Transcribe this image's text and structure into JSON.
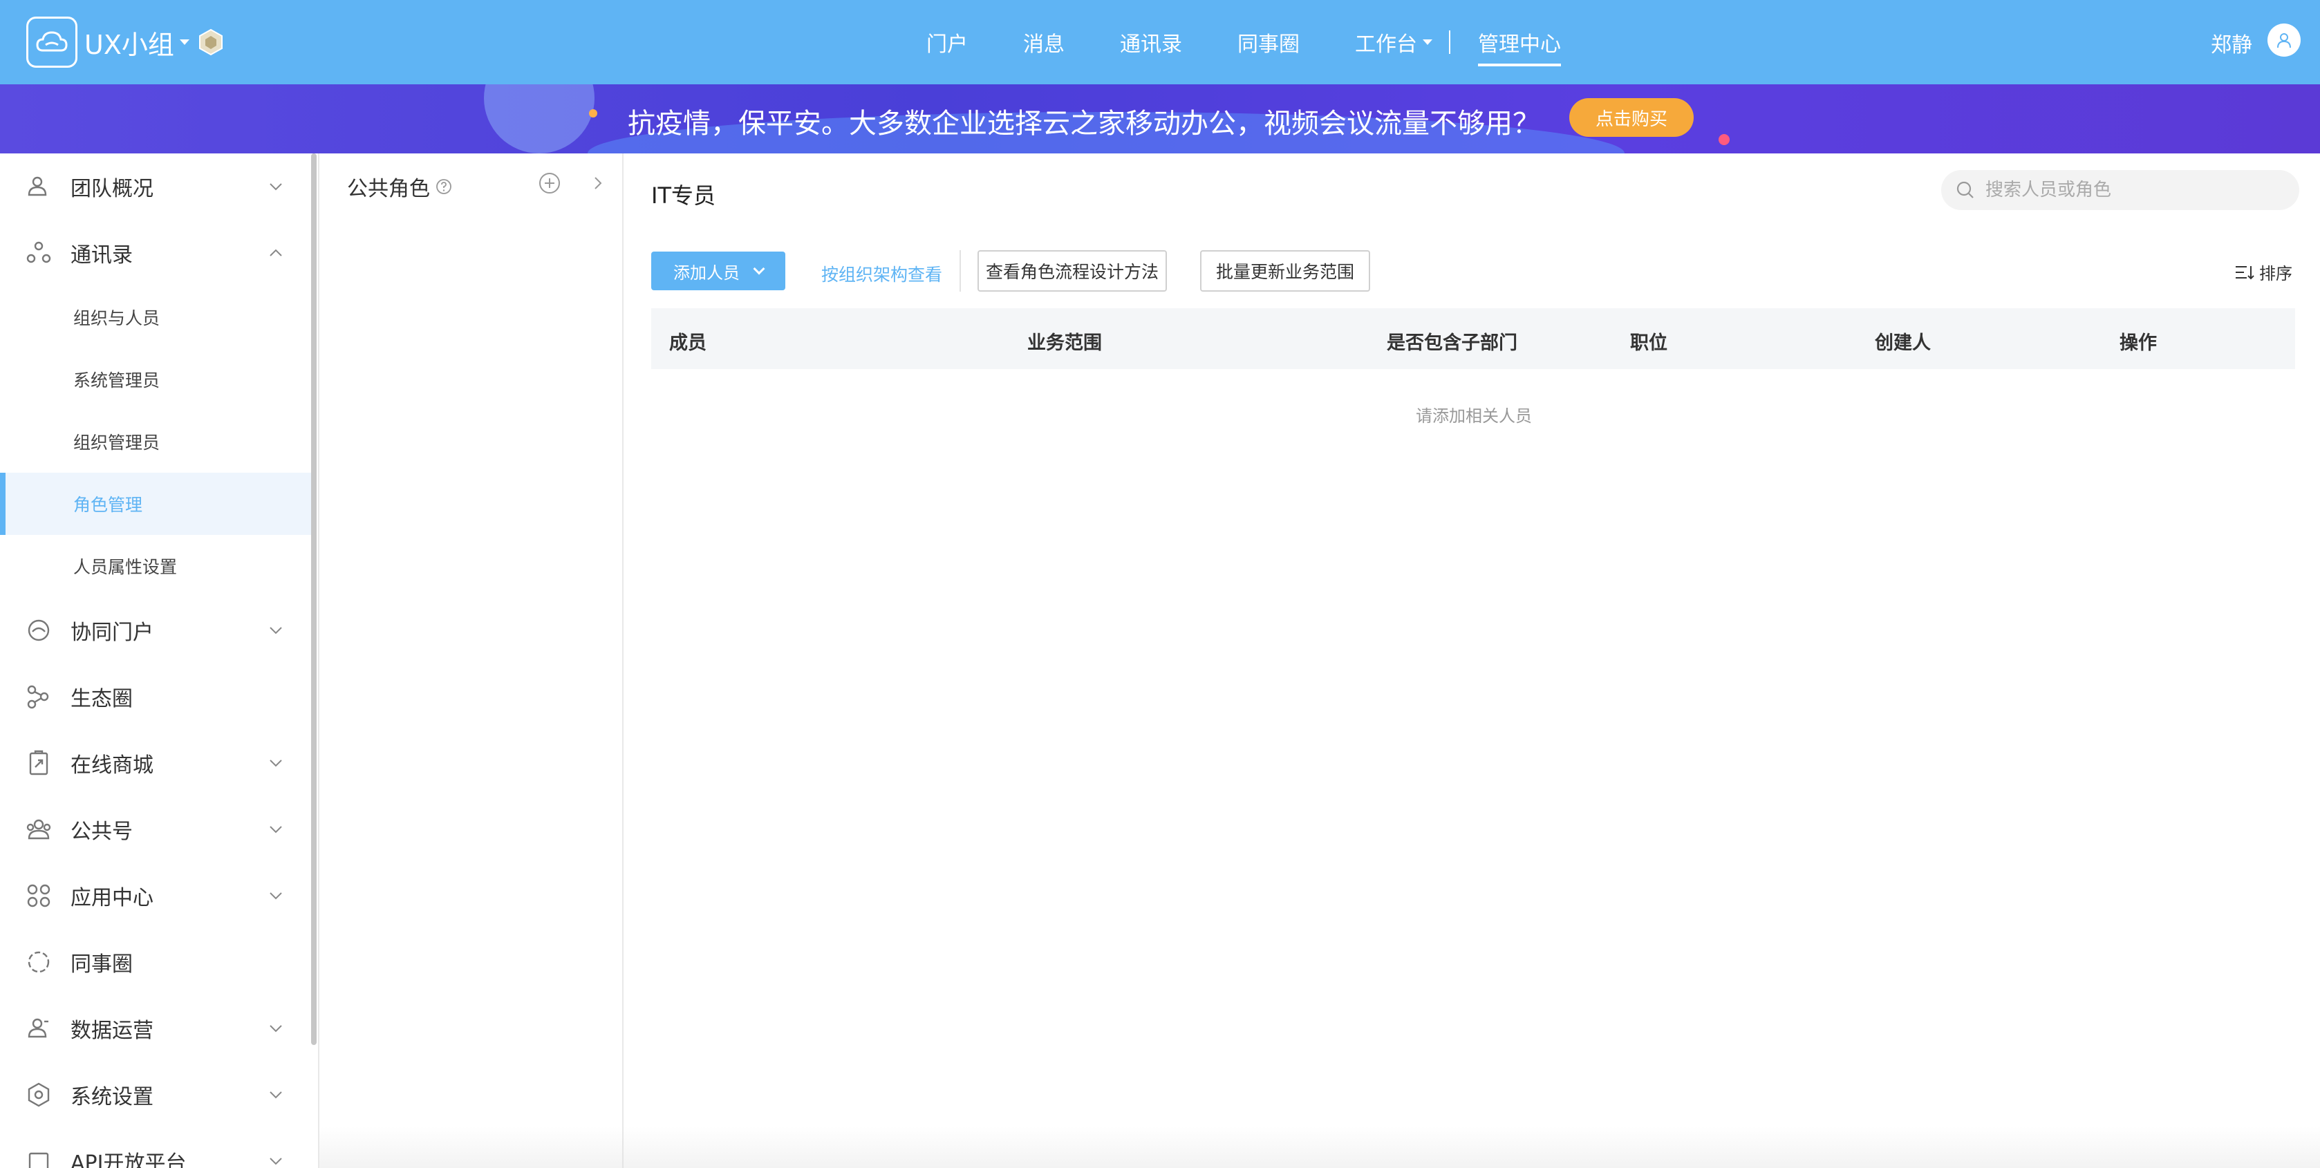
{
  "header": {
    "team_name": "UX小组",
    "nav": [
      {
        "label": "门户"
      },
      {
        "label": "消息"
      },
      {
        "label": "通讯录"
      },
      {
        "label": "同事圈"
      },
      {
        "label": "工作台"
      },
      {
        "label": "管理中心"
      }
    ],
    "user_name": "郑静"
  },
  "banner": {
    "text": "抗疫情，保平安。大多数企业选择云之家移动办公，视频会议流量不够用？",
    "button": "点击购买"
  },
  "sidebar": {
    "items": [
      {
        "label": "团队概况",
        "icon": "team-icon"
      },
      {
        "label": "通讯录",
        "icon": "contacts-icon"
      },
      {
        "label": "协同门户",
        "icon": "portal-icon"
      },
      {
        "label": "生态圈",
        "icon": "ecosystem-icon"
      },
      {
        "label": "在线商城",
        "icon": "shop-icon"
      },
      {
        "label": "公共号",
        "icon": "public-account-icon"
      },
      {
        "label": "应用中心",
        "icon": "apps-icon"
      },
      {
        "label": "同事圈",
        "icon": "colleague-circle-icon"
      },
      {
        "label": "数据运营",
        "icon": "data-ops-icon"
      },
      {
        "label": "系统设置",
        "icon": "settings-icon"
      },
      {
        "label": "API开放平台",
        "icon": "api-icon"
      }
    ],
    "contacts_sub": [
      {
        "label": "组织与人员"
      },
      {
        "label": "系统管理员"
      },
      {
        "label": "组织管理员"
      },
      {
        "label": "角色管理"
      },
      {
        "label": "人员属性设置"
      }
    ]
  },
  "roles_panel": {
    "title": "公共角色"
  },
  "main": {
    "title": "IT专员",
    "search_placeholder": "搜索人员或角色",
    "add_button": "添加人员",
    "org_link": "按组织架构查看",
    "flow_button": "查看角色流程设计方法",
    "batch_button": "批量更新业务范围",
    "sort_label": "排序",
    "columns": [
      "成员",
      "业务范围",
      "是否包含子部门",
      "职位",
      "创建人",
      "操作"
    ],
    "empty_text": "请添加相关人员"
  },
  "colors": {
    "accent": "#5fb4f4",
    "banner": "#4a3fd8",
    "buy_button": "#f6a93b"
  }
}
